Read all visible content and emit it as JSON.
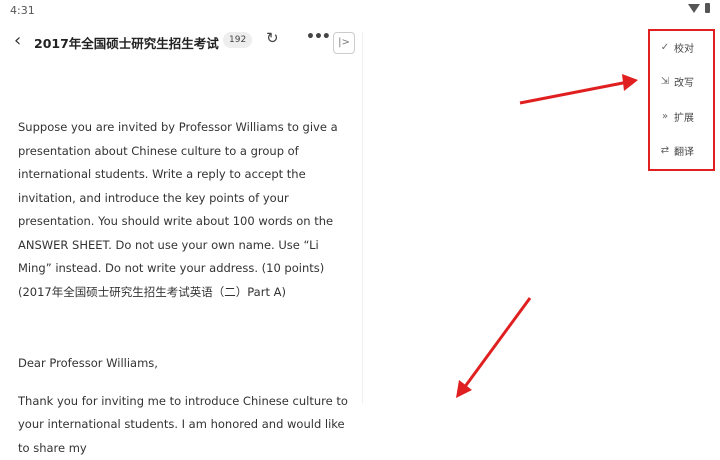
{
  "status_bar": {
    "time": "4:31",
    "wifi_icon": "wifi-icon",
    "battery_icon": "battery-icon"
  },
  "toolbar": {
    "back_icon": "chevron-left-icon",
    "title": "2017年全国硕士研究生招生考试",
    "count_badge": "192",
    "refresh_icon": "refresh-icon",
    "more_icon": "more-horizontal-icon",
    "collapse_label": "|>"
  },
  "document": {
    "paragraphs": [
      "Suppose you are invited by Professor Williams to give a presentation about Chinese culture to a group of international students. Write a reply to accept the invitation, and introduce the key points of your presentation. You should write about 100 words on the ANSWER SHEET. Do not use your own name. Use “Li Ming” instead. Do not write your address. (10 points)(2017年全国硕士研究生招生考试英语（二）Part A)",
      "Dear Professor Williams,",
      "Thank you for inviting me to introduce Chinese culture to your international students. I am honored and would like to share my"
    ]
  },
  "side_menu": {
    "items": [
      {
        "icon": "check-icon",
        "glyph": "✓",
        "label": "校对"
      },
      {
        "icon": "rewrite-icon",
        "glyph": "⇲",
        "label": "改写"
      },
      {
        "icon": "expand-icon",
        "glyph": "»",
        "label": "扩展"
      },
      {
        "icon": "translate-icon",
        "glyph": "⇄",
        "label": "翻译"
      }
    ]
  },
  "colors": {
    "annotation_red": "#e02020",
    "text": "#333333",
    "background": "#ffffff"
  }
}
